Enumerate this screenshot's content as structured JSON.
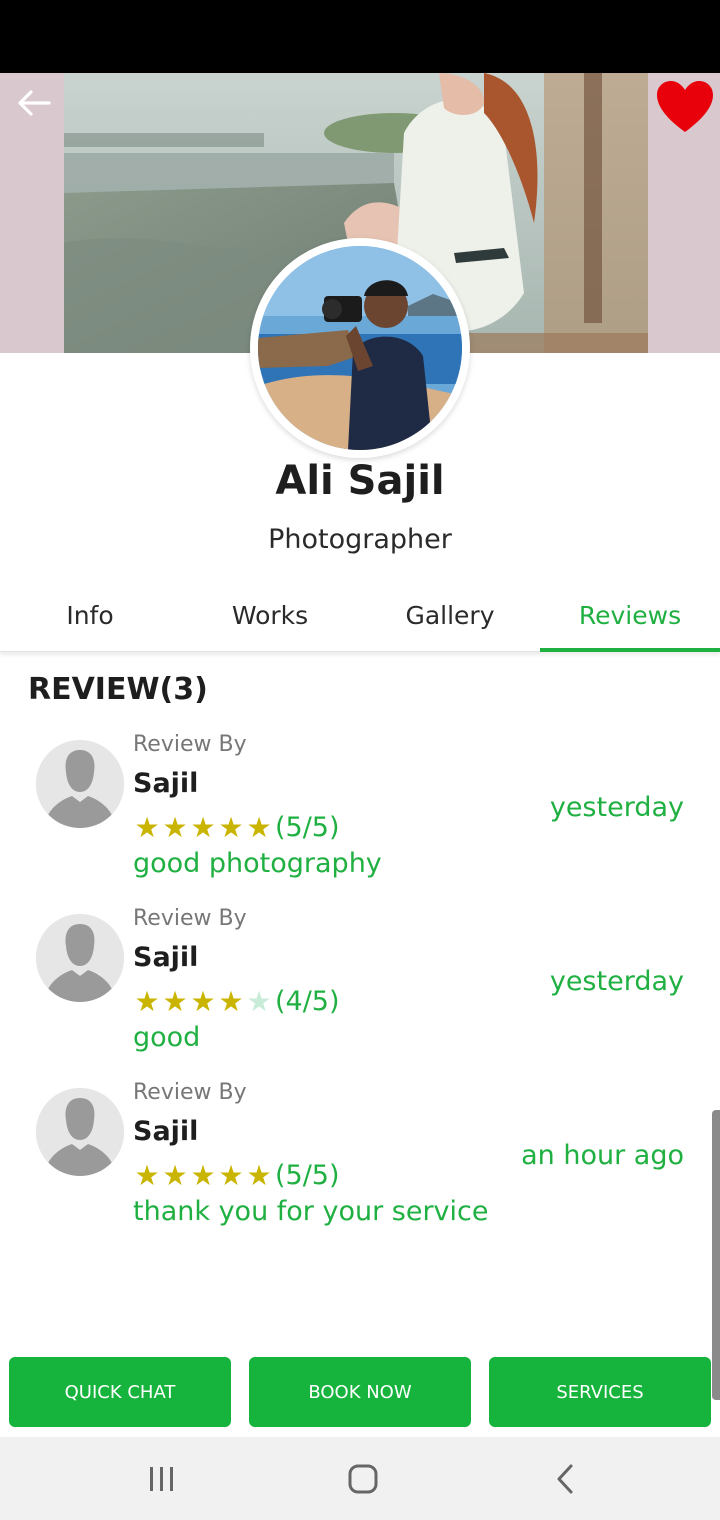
{
  "profile": {
    "name": "Ali Sajil",
    "role": "Photographer",
    "favorited": true
  },
  "tabs": [
    {
      "label": "Info",
      "active": false
    },
    {
      "label": "Works",
      "active": false
    },
    {
      "label": "Gallery",
      "active": false
    },
    {
      "label": "Reviews",
      "active": true
    }
  ],
  "reviews_section": {
    "heading": "REVIEW(3)",
    "items": [
      {
        "by_label": "Review By",
        "name": "Sajil",
        "rating": 5,
        "score_label": "(5/5)",
        "comment": "good photography",
        "time": "yesterday"
      },
      {
        "by_label": "Review By",
        "name": "Sajil",
        "rating": 4,
        "score_label": "(4/5)",
        "comment": "good",
        "time": "yesterday"
      },
      {
        "by_label": "Review By",
        "name": "Sajil",
        "rating": 5,
        "score_label": "(5/5)",
        "comment": "thank you for your service",
        "time": "an hour ago"
      }
    ]
  },
  "actions": {
    "quick_chat": "QUICK CHAT",
    "book_now": "BOOK NOW",
    "services": "SERVICES"
  },
  "icons": {
    "back": "arrow-left-icon",
    "favorite": "heart-icon",
    "nav_recents": "recents-icon",
    "nav_home": "home-icon",
    "nav_back": "back-chevron-icon"
  },
  "colors": {
    "accent": "#1fb041",
    "button": "#16b43c",
    "star": "#c9b400",
    "star_empty": "#c8ecd8",
    "heart": "#e8000b"
  }
}
